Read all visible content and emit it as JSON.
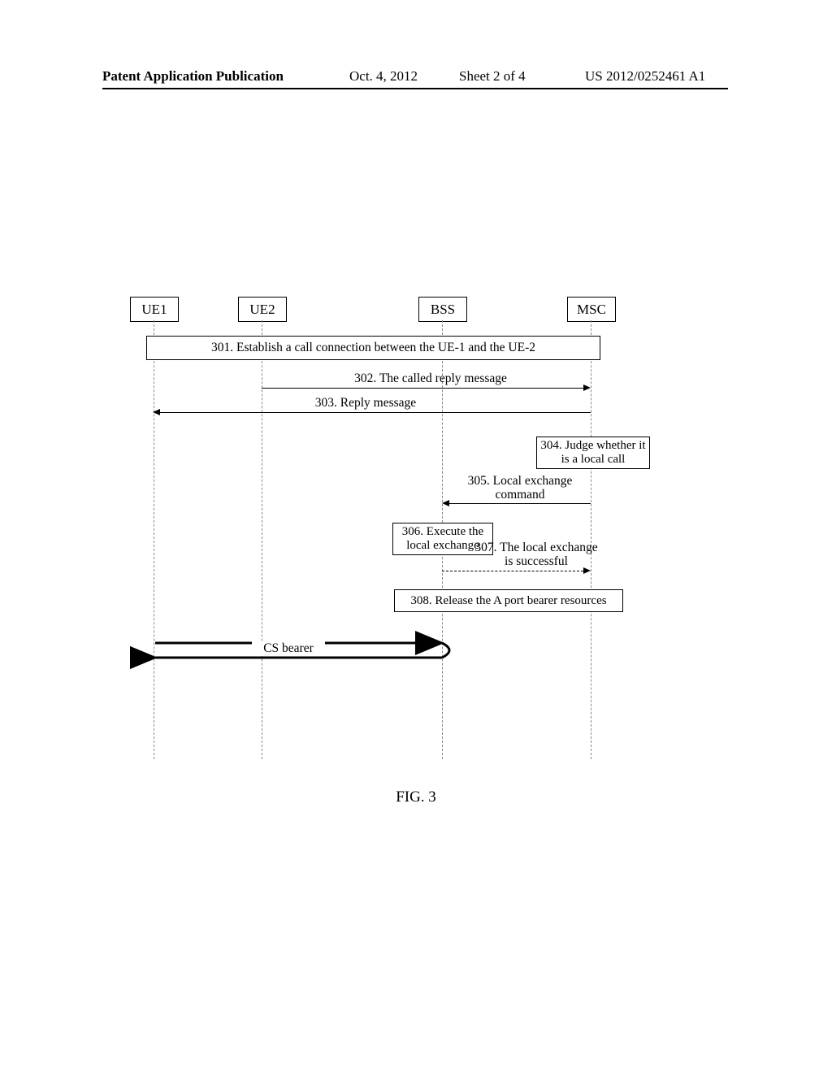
{
  "header": {
    "left": "Patent Application Publication",
    "date": "Oct. 4, 2012",
    "sheet": "Sheet 2 of 4",
    "pubno": "US 2012/0252461 A1"
  },
  "actors": {
    "ue1": "UE1",
    "ue2": "UE2",
    "bss": "BSS",
    "msc": "MSC"
  },
  "steps": {
    "s301": "301. Establish a call connection between the UE-1 and the UE-2",
    "s302": "302. The called reply message",
    "s303": "303. Reply message",
    "s304": "304. Judge whether it is a local call",
    "s305": "305. Local exchange command",
    "s306": "306. Execute the local exchange",
    "s307": "307. The local exchange is successful",
    "s308": "308. Release the A port bearer resources",
    "cs": "CS bearer"
  },
  "caption": "FIG. 3"
}
